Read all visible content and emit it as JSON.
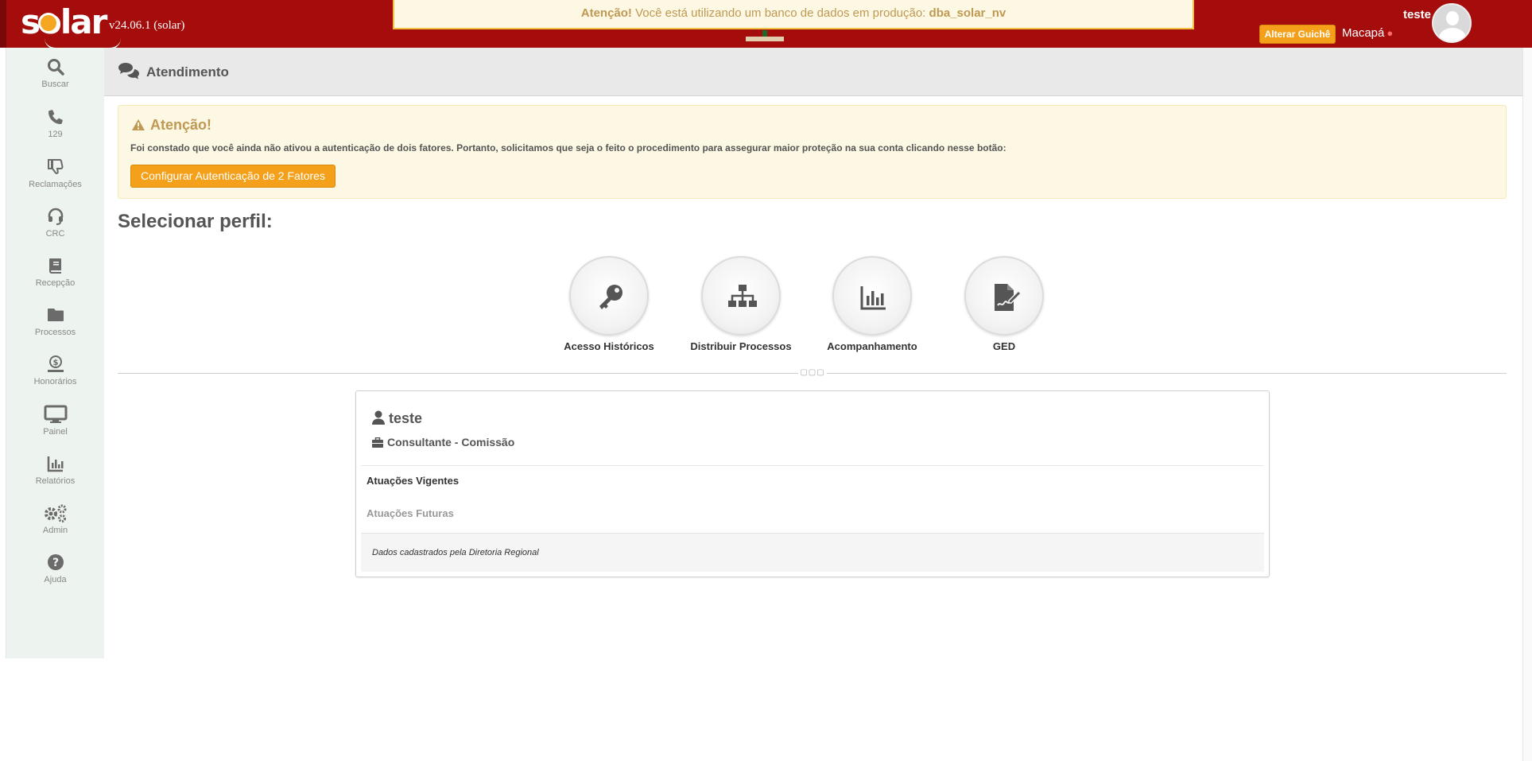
{
  "app": {
    "logo_text": "solar",
    "version": "v24.06.1 (solar)",
    "prod_alert_prefix": "Atenção!",
    "prod_alert_text": " Você está utilizando um banco de dados em produção: ",
    "prod_alert_db": "dba_solar_nv",
    "alter_guiche_label": "Alterar Guichê",
    "user_name": "teste",
    "user_city": "Macapá",
    "colors": {
      "brand_red": "#a50c0c",
      "accent_orange": "#f5a01a",
      "warn_bg": "#fcf8e3",
      "warn_text": "#c09853"
    }
  },
  "sidebar": {
    "items": [
      {
        "label": "Buscar",
        "icon": "search-icon"
      },
      {
        "label": "129",
        "icon": "phone-icon"
      },
      {
        "label": "Reclamações",
        "icon": "thumbs-down-icon"
      },
      {
        "label": "CRC",
        "icon": "headset-icon"
      },
      {
        "label": "Recepção",
        "icon": "book-icon"
      },
      {
        "label": "Processos",
        "icon": "folder-icon"
      },
      {
        "label": "Honorários",
        "icon": "money-hand-icon"
      },
      {
        "label": "Painel",
        "icon": "monitor-icon"
      },
      {
        "label": "Relatórios",
        "icon": "bar-chart-icon"
      },
      {
        "label": "Admin",
        "icon": "gears-icon"
      },
      {
        "label": "Ajuda",
        "icon": "question-circle-icon"
      }
    ]
  },
  "main": {
    "header_title": "Atendimento",
    "warning": {
      "title": "Atenção!",
      "text": "Foi constado que você ainda não ativou a autenticação de dois fatores. Portanto, solicitamos que seja o feito o procedimento para assegurar maior proteção na sua conta clicando nesse botão:",
      "button_label": "Configurar Autenticação de 2 Fatores"
    },
    "select_profile_title": "Selecionar perfil:",
    "profiles": [
      {
        "label": "Acesso Históricos",
        "icon": "key-icon"
      },
      {
        "label": "Distribuir Processos",
        "icon": "sitemap-icon"
      },
      {
        "label": "Acompanhamento",
        "icon": "bar-chart-icon"
      },
      {
        "label": "GED",
        "icon": "document-sign-icon"
      }
    ],
    "divider_dots": "▢▢▢",
    "card": {
      "user": "teste",
      "role": "Consultante - Comissão",
      "current_label": "Atuações Vigentes",
      "future_label": "Atuações Futuras",
      "footer_note": "Dados cadastrados pela Diretoria Regional"
    }
  }
}
